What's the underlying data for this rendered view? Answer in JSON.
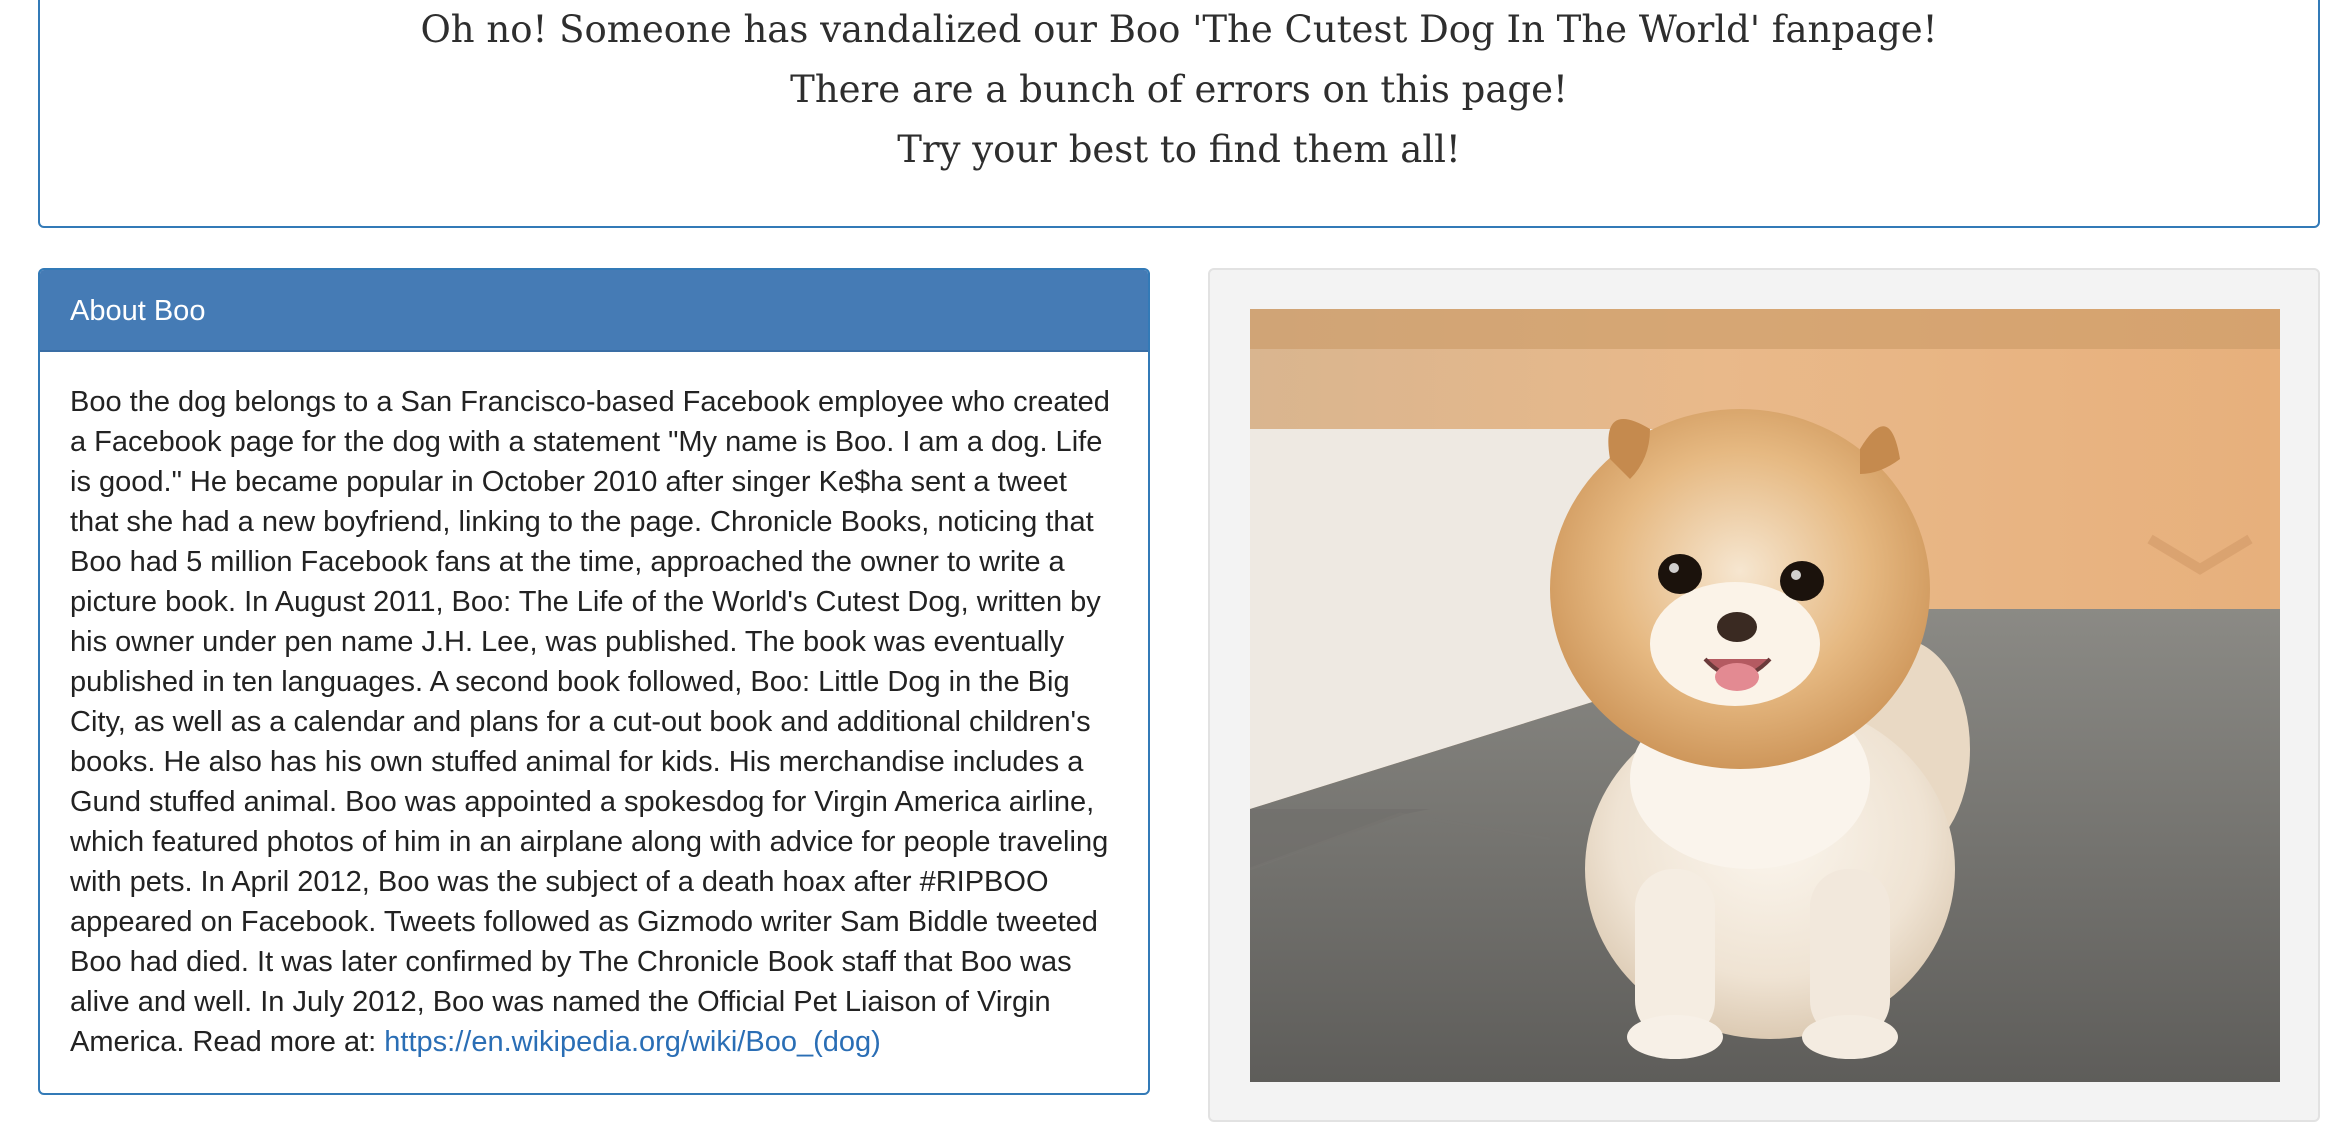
{
  "intro": {
    "lines": [
      "Oh no! Someone has vandalized our Boo 'The Cutest Dog In The World' fanpage!",
      "There are a bunch of errors on this page!",
      "Try your best to find them all!"
    ]
  },
  "about": {
    "heading": "About Boo",
    "text": "Boo the dog belongs to a San Francisco-based Facebook employee who created a Facebook page for the dog with a statement \"My name is Boo. I am a dog. Life is good.\" He became popular in October 2010 after singer Ke$ha sent a tweet that she had a new boyfriend, linking to the page. Chronicle Books, noticing that Boo had 5 million Facebook fans at the time, approached the owner to write a picture book. In August 2011, Boo: The Life of the World's Cutest Dog, written by his owner under pen name J.H. Lee, was published. The book was eventually published in ten languages. A second book followed, Boo: Little Dog in the Big City, as well as a calendar and plans for a cut-out book and additional children's books. He also has his own stuffed animal for kids. His merchandise includes a Gund stuffed animal. Boo was appointed a spokesdog for Virgin America airline, which featured photos of him in an airplane along with advice for people traveling with pets. In April 2012, Boo was the subject of a death hoax after #RIPBOO appeared on Facebook. Tweets followed as Gizmodo writer Sam Biddle tweeted Boo had died. It was later confirmed by The Chronicle Book staff that Boo was alive and well. In July 2012, Boo was named the Official Pet Liaison of Virgin America. Read more at: ",
    "link_text": "https://en.wikipedia.org/wiki/Boo_(dog)",
    "link_href": "https://en.wikipedia.org/wiki/Boo_(dog)"
  },
  "photo": {
    "alt": "Boo the Pomeranian dog"
  },
  "colors": {
    "panel_primary": "#337ab7",
    "panel_heading_bg": "#457bb5",
    "link": "#2a6eb5",
    "well_bg": "#f3f3f3"
  }
}
